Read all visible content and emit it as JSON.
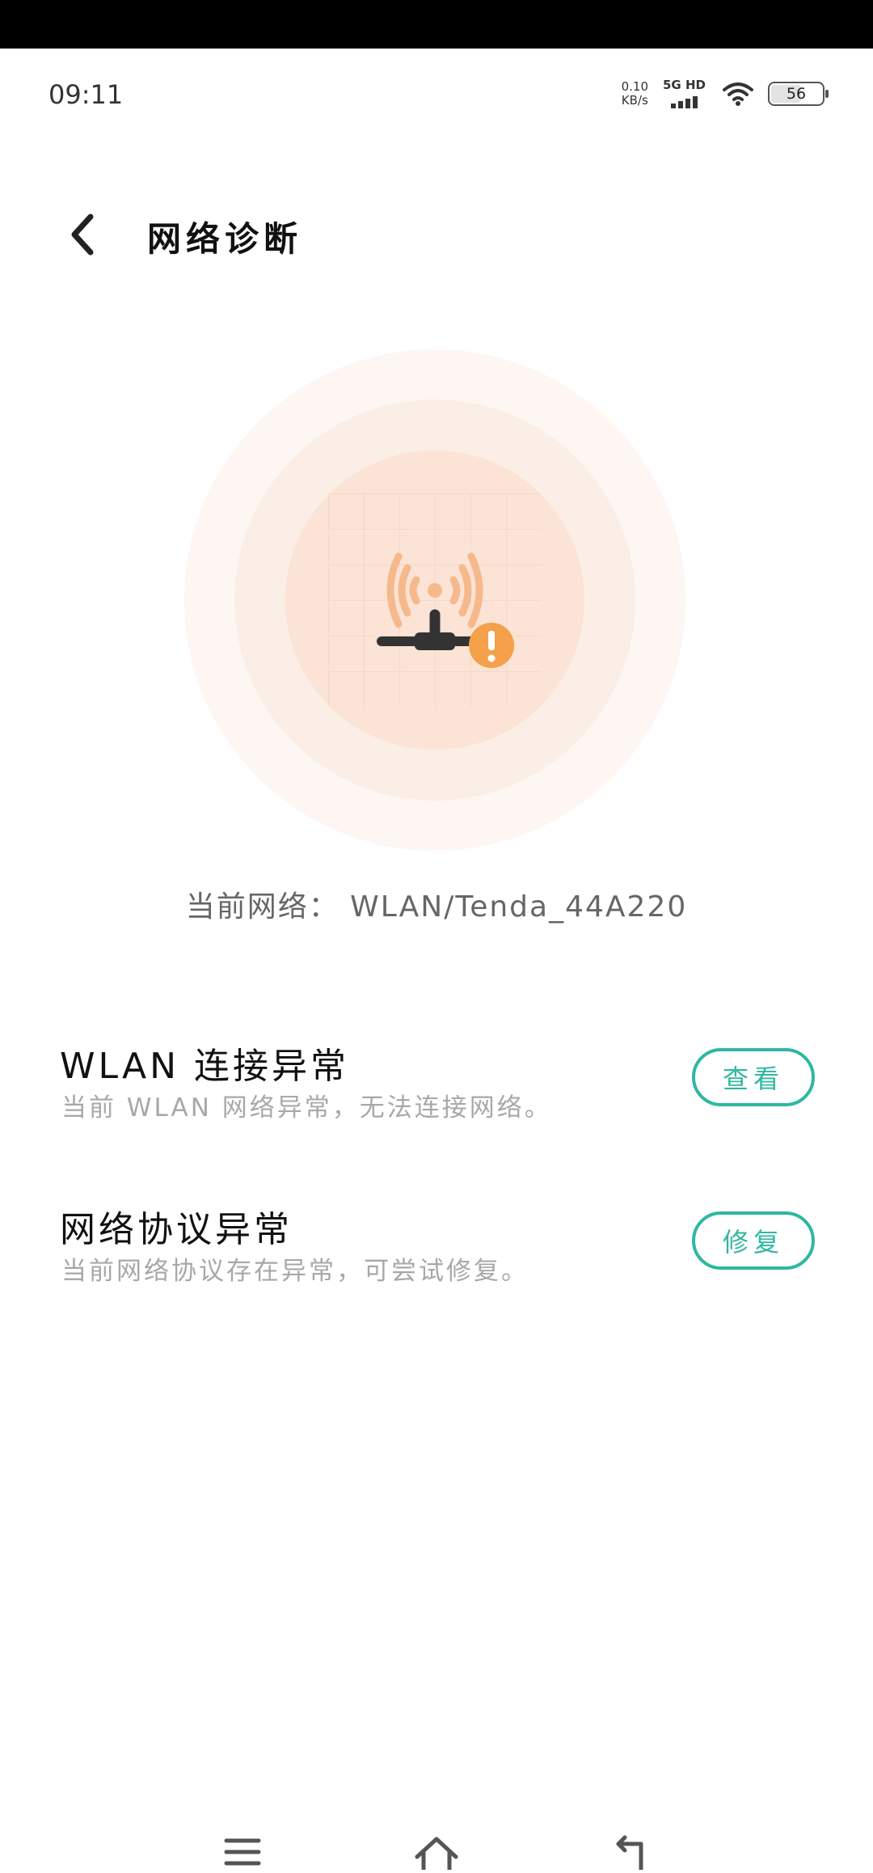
{
  "status_bar": {
    "time": "09:11",
    "speed_value": "0.10",
    "speed_unit": "KB/s",
    "network_type": "5G HD",
    "battery": "56",
    "battery_level": 0.56
  },
  "header": {
    "title": "网络诊断",
    "back_icon": "chevron-left-icon"
  },
  "hero": {
    "icon": "router-warning-icon",
    "accent_color": "#f5a04a"
  },
  "current_network": "当前网络： WLAN/Tenda_44A220",
  "issues": [
    {
      "title": "WLAN 连接异常",
      "description": "当前 WLAN 网络异常，无法连接网络。",
      "button": "查看"
    },
    {
      "title": "网络协议异常",
      "description": "当前网络协议存在异常，可尝试修复。",
      "button": "修复"
    }
  ],
  "colors": {
    "button": "#2eb8a0",
    "warning": "#f5a04a"
  },
  "nav_bar": {
    "icons": [
      "menu-icon",
      "home-icon",
      "back-icon"
    ]
  }
}
